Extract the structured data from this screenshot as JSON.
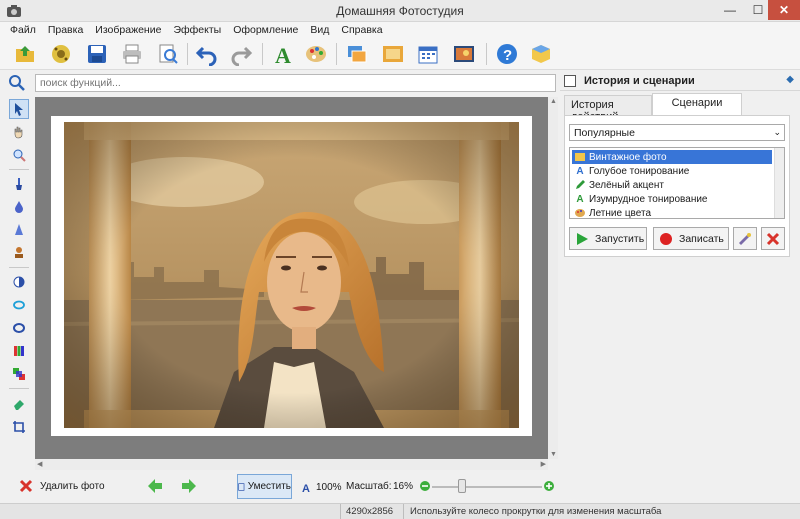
{
  "window": {
    "title": "Домашняя Фотостудия"
  },
  "menu": [
    "Файл",
    "Правка",
    "Изображение",
    "Эффекты",
    "Оформление",
    "Вид",
    "Справка"
  ],
  "toolbar": {
    "icons": [
      "open-photo-icon",
      "gallery-icon",
      "save-icon",
      "print-icon",
      "preview-icon",
      "undo-icon",
      "redo-icon",
      "text-icon",
      "palette-icon",
      "frames-icon",
      "picture-icon",
      "calendar-icon",
      "collage-icon",
      "help-icon",
      "package-icon"
    ]
  },
  "search": {
    "placeholder": "поиск функций..."
  },
  "panel": {
    "title": "История и сценарии",
    "tabs": [
      {
        "label": "История действий",
        "active": false
      },
      {
        "label": "Сценарии",
        "active": true
      }
    ],
    "category_select": "Популярные",
    "scenarios": [
      {
        "label": "Винтажное фото",
        "icon": "vintage-icon",
        "selected": true
      },
      {
        "label": "Голубое тонирование",
        "icon": "letter-a-blue-icon",
        "selected": false
      },
      {
        "label": "Зелёный акцент",
        "icon": "pencil-green-icon",
        "selected": false
      },
      {
        "label": "Изумрудное тонирование",
        "icon": "letter-a-green-icon",
        "selected": false
      },
      {
        "label": "Летние цвета",
        "icon": "palette-icon",
        "selected": false
      }
    ],
    "run_label": "Запустить",
    "record_label": "Записать"
  },
  "bottom": {
    "delete_label": "Удалить фото",
    "fit_label": "Уместить",
    "actual_label": "100%",
    "zoom_label": "Масштаб:",
    "zoom_value": "16%",
    "zoom_fraction": 0.25
  },
  "status": {
    "dimensions": "4290x2856",
    "hint": "Используйте колесо прокрутки для изменения масштаба"
  },
  "colors": {
    "accent": "#3875d7",
    "close": "#c7503f",
    "canvas": "#7d7d7d"
  }
}
